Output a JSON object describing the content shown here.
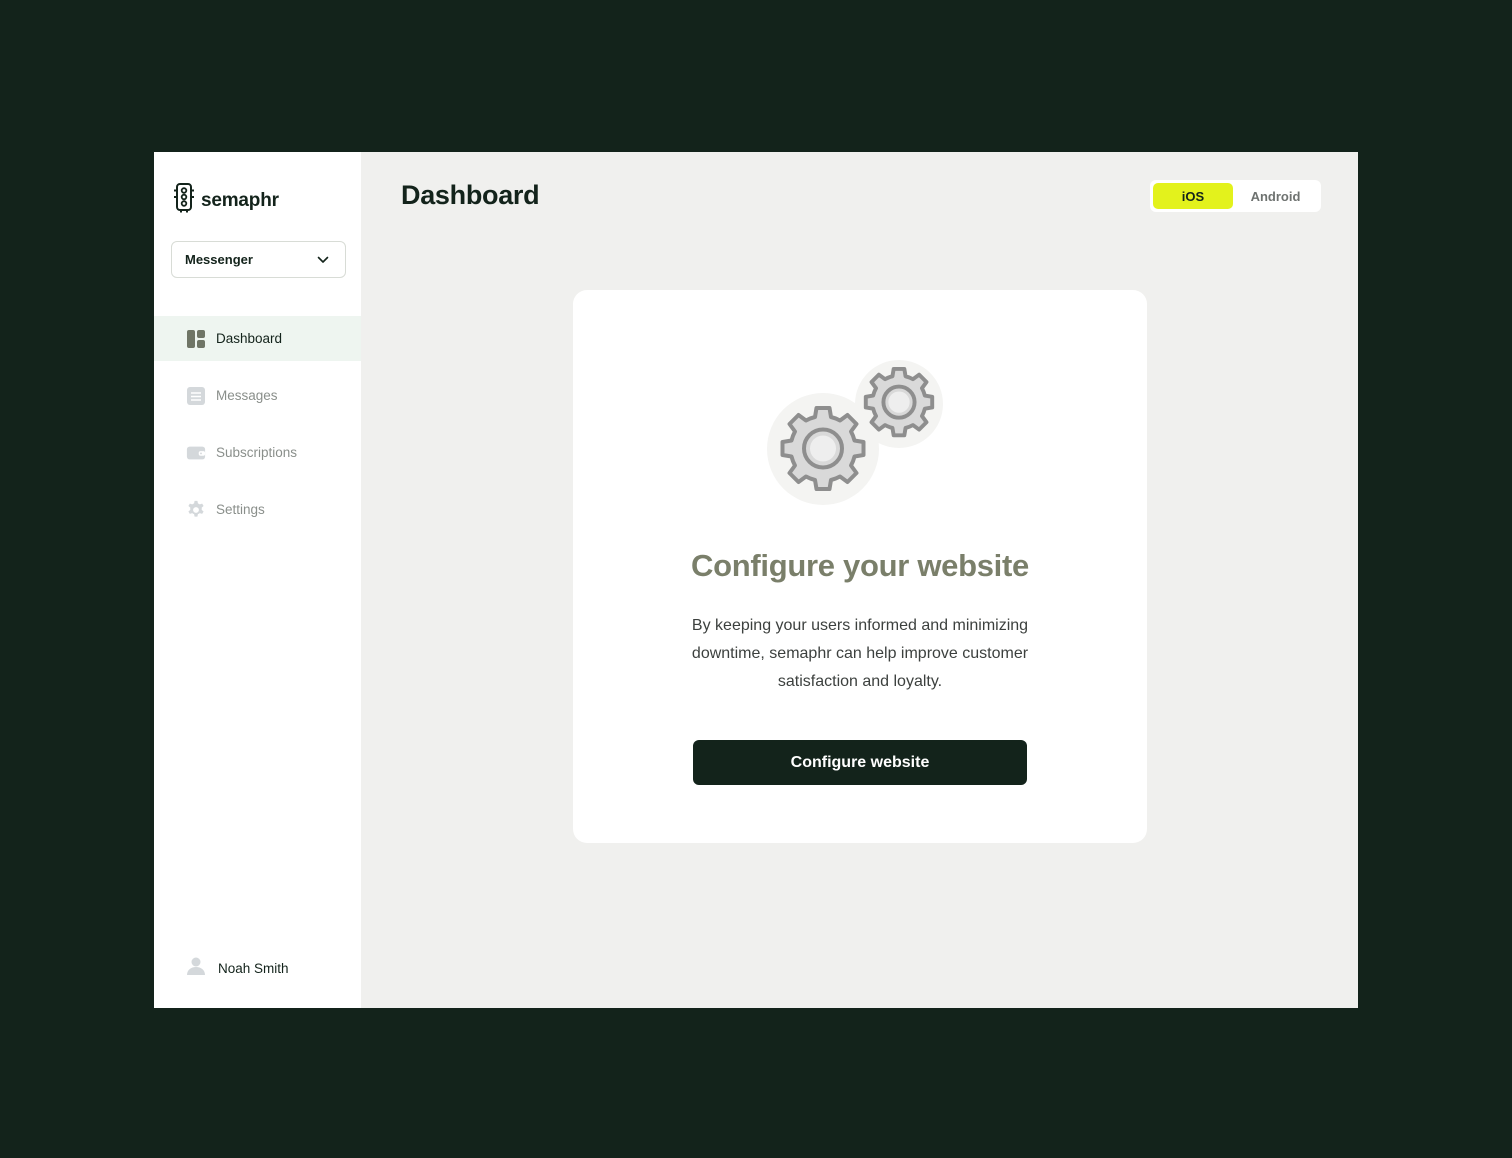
{
  "brand": {
    "name": "semaphr",
    "icon": "traffic-light-icon"
  },
  "workspace_select": {
    "value": "Messenger",
    "icon": "chevron-down-icon"
  },
  "sidebar": {
    "items": [
      {
        "label": "Dashboard",
        "icon": "dashboard-icon",
        "active": true
      },
      {
        "label": "Messages",
        "icon": "messages-icon",
        "active": false
      },
      {
        "label": "Subscriptions",
        "icon": "wallet-icon",
        "active": false
      },
      {
        "label": "Settings",
        "icon": "gear-icon",
        "active": false
      }
    ]
  },
  "user": {
    "name": "Noah Smith",
    "icon": "user-icon"
  },
  "header": {
    "title": "Dashboard"
  },
  "platform_toggle": {
    "options": [
      "iOS",
      "Android"
    ],
    "selected": "iOS"
  },
  "card": {
    "title": "Configure your website",
    "description": "By keeping your users informed and minimizing downtime, semaphr can help improve customer satisfaction and loyalty.",
    "button_label": "Configure website",
    "illustration": "gears-icon"
  },
  "colors": {
    "background": "#13231b",
    "accent": "#e3f21c",
    "primary": "#13231b",
    "surface": "#f0f0ee",
    "active_nav": "#eef5f0"
  }
}
